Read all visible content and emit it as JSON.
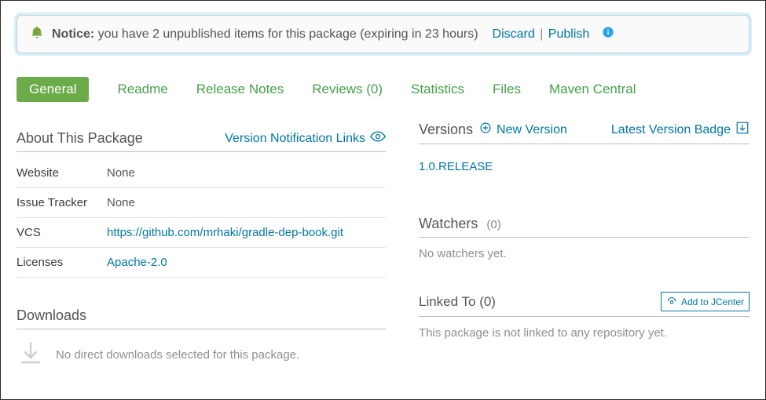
{
  "notice": {
    "label": "Notice:",
    "text": " you have 2 unpublished items for this package (expiring in 23 hours)",
    "discard": "Discard",
    "publish": "Publish",
    "sep": " | "
  },
  "tabs": {
    "general": "General",
    "readme": "Readme",
    "release_notes": "Release Notes",
    "reviews": "Reviews (0)",
    "statistics": "Statistics",
    "files": "Files",
    "maven_central": "Maven Central"
  },
  "about": {
    "title": "About This Package",
    "vnl": "Version Notification Links",
    "rows": {
      "website_k": "Website",
      "website_v": "None",
      "issue_k": "Issue Tracker",
      "issue_v": "None",
      "vcs_k": "VCS",
      "vcs_v": "https://github.com/mrhaki/gradle-dep-book.git",
      "lic_k": "Licenses",
      "lic_v": "Apache-2.0"
    }
  },
  "downloads": {
    "title": "Downloads",
    "empty": "No direct downloads selected for this package."
  },
  "versions": {
    "title": "Versions",
    "new": "New Version",
    "badge": "Latest Version Badge",
    "item": "1.0.RELEASE"
  },
  "watchers": {
    "title": "Watchers",
    "count": "(0)",
    "empty": "No watchers yet."
  },
  "linked": {
    "title": "Linked To (0)",
    "add": "Add to JCenter",
    "empty": "This package is not linked to any repository yet."
  }
}
